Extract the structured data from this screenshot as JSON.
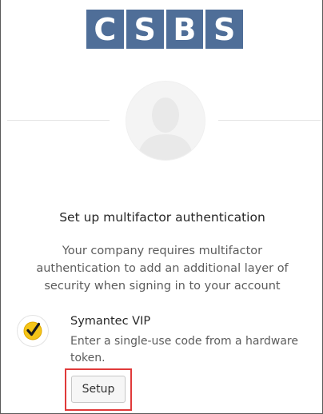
{
  "logo": {
    "letters": [
      "C",
      "S",
      "B",
      "S"
    ],
    "color": "#4f6e98"
  },
  "avatar": {
    "icon": "user-silhouette-icon"
  },
  "heading": {
    "title": "Set up multifactor authentication",
    "description": "Your company requires multifactor authentication to add an additional layer of security when signing in to your account"
  },
  "factor": {
    "icon": "symantec-vip-check-icon",
    "icon_color": "#f5c518",
    "name": "Symantec VIP",
    "description": "Enter a single-use code from a hardware token.",
    "button_label": "Setup"
  },
  "highlight_color": "#e03a3a"
}
